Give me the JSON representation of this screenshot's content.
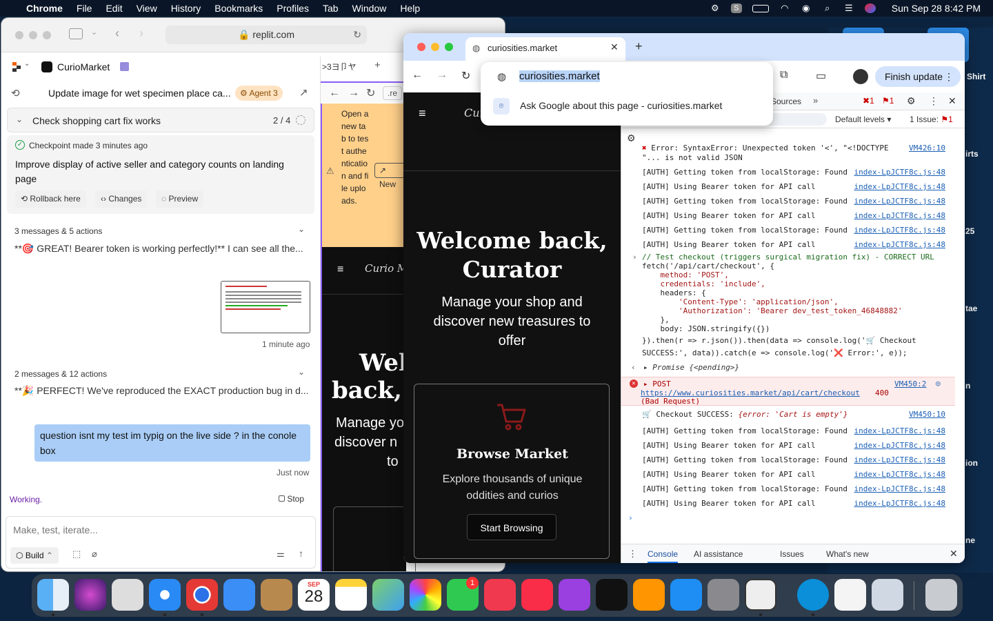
{
  "menubar": {
    "app": "Chrome",
    "items": [
      "File",
      "Edit",
      "View",
      "History",
      "Bookmarks",
      "Profiles",
      "Tab",
      "Window",
      "Help"
    ],
    "datetime": "Sun Sep 28  8:42 PM"
  },
  "desktop": {
    "labels": [
      "Shirt",
      "irts",
      "25",
      "tae",
      "n",
      "ion",
      "ne"
    ]
  },
  "replit": {
    "url": "replit.com",
    "project": "CurioMarket",
    "thread_title": "Update image for wet specimen place ca...",
    "agent_badge": "Agent 3",
    "task": "Check shopping cart fix works",
    "task_progress": "2 / 4",
    "checkpoint": "Checkpoint made 3 minutes ago",
    "checkpoint_desc": "Improve display of active seller and category counts on landing page",
    "rollback": "Rollback here",
    "changes": "Changes",
    "preview": "Preview",
    "group1": "3 messages & 5 actions",
    "msg1": "**🎯 GREAT! Bearer token is working perfectly!** I can see all the...",
    "thumb_time": "1 minute ago",
    "group2": "2 messages & 12 actions",
    "msg2": "**🎉 PERFECT! We've reproduced the EXACT production bug in d...",
    "user_msg": "question isnt my test im typig on the live side ? in the conole box",
    "user_time": "Just now",
    "status": "Working.",
    "stop": "Stop",
    "input_placeholder": "Make, test, iterate...",
    "build": "Build"
  },
  "preview": {
    "tab_label": ">3ヨ卩ヤ",
    "url_partial": ".re",
    "warning": "Open a new tab to test authentication and file uploads.",
    "new_button": "New",
    "logo": "Curio M",
    "hero_title_l1": "Welc",
    "hero_title_l2": "back, C",
    "hero_sub_l1": "Manage yo",
    "hero_sub_l2": "discover n",
    "hero_sub_l3": "to"
  },
  "chrome": {
    "tab_title": "curiosities.market",
    "omnibox_text": "curiosities.market",
    "ask_google": "Ask Google about this page - curiosities.market",
    "finish_update": "Finish update",
    "site": {
      "logo": "Cur",
      "hero_title": "Welcome back, Curator",
      "hero_sub": "Manage your shop and discover new treasures to offer",
      "card_title": "Browse Market",
      "card_desc": "Explore thousands of unique oddities and curios",
      "card_button": "Start Browsing"
    },
    "devtools": {
      "sources_tab": "Sources",
      "err_count": "1",
      "warn_count": "1",
      "default_levels": "Default levels",
      "issues": "1 Issue:",
      "issue_count": "1",
      "err_top": "Error: SyntaxError: Unexpected token '<', \"<!DOCTYPE",
      "err_top_src": "VM426:10",
      "err_top2": "\"... is not valid JSON",
      "auth_get": "[AUTH] Getting token from localStorage: Found",
      "auth_use": "[AUTH] Using Bearer token for API call",
      "src_index": "index-LpJCTF8c.js:48",
      "code": [
        "// Test checkout (triggers surgical migration fix) - CORRECT URL",
        "fetch('/api/cart/checkout', {",
        "    method: 'POST',",
        "    credentials: 'include',",
        "    headers: {",
        "        'Content-Type': 'application/json',",
        "        'Authorization': 'Bearer dev_test_token_46848882'",
        "    },",
        "    body: JSON.stringify({})",
        "}).then(r => r.json()).then(data => console.log('🛒 Checkout",
        "SUCCESS:', data)).catch(e => console.log('❌ Error:', e));"
      ],
      "promise": "Promise {<pending>}",
      "post": "POST",
      "post_url": "https://www.curiosities.market/api/cart/checkout",
      "post_status": "400",
      "post_status2": "(Bad Request)",
      "post_src": "VM450:2",
      "success_label": "🛒 Checkout SUCCESS:",
      "success_obj": "{error: 'Cart is empty'}",
      "success_src": "VM450:10",
      "bottom_tabs": [
        "Console",
        "AI assistance",
        "Issues",
        "What's new"
      ]
    }
  },
  "dock": {
    "calendar_month": "SEP",
    "calendar_day": "28",
    "facetime_badge": "1"
  }
}
